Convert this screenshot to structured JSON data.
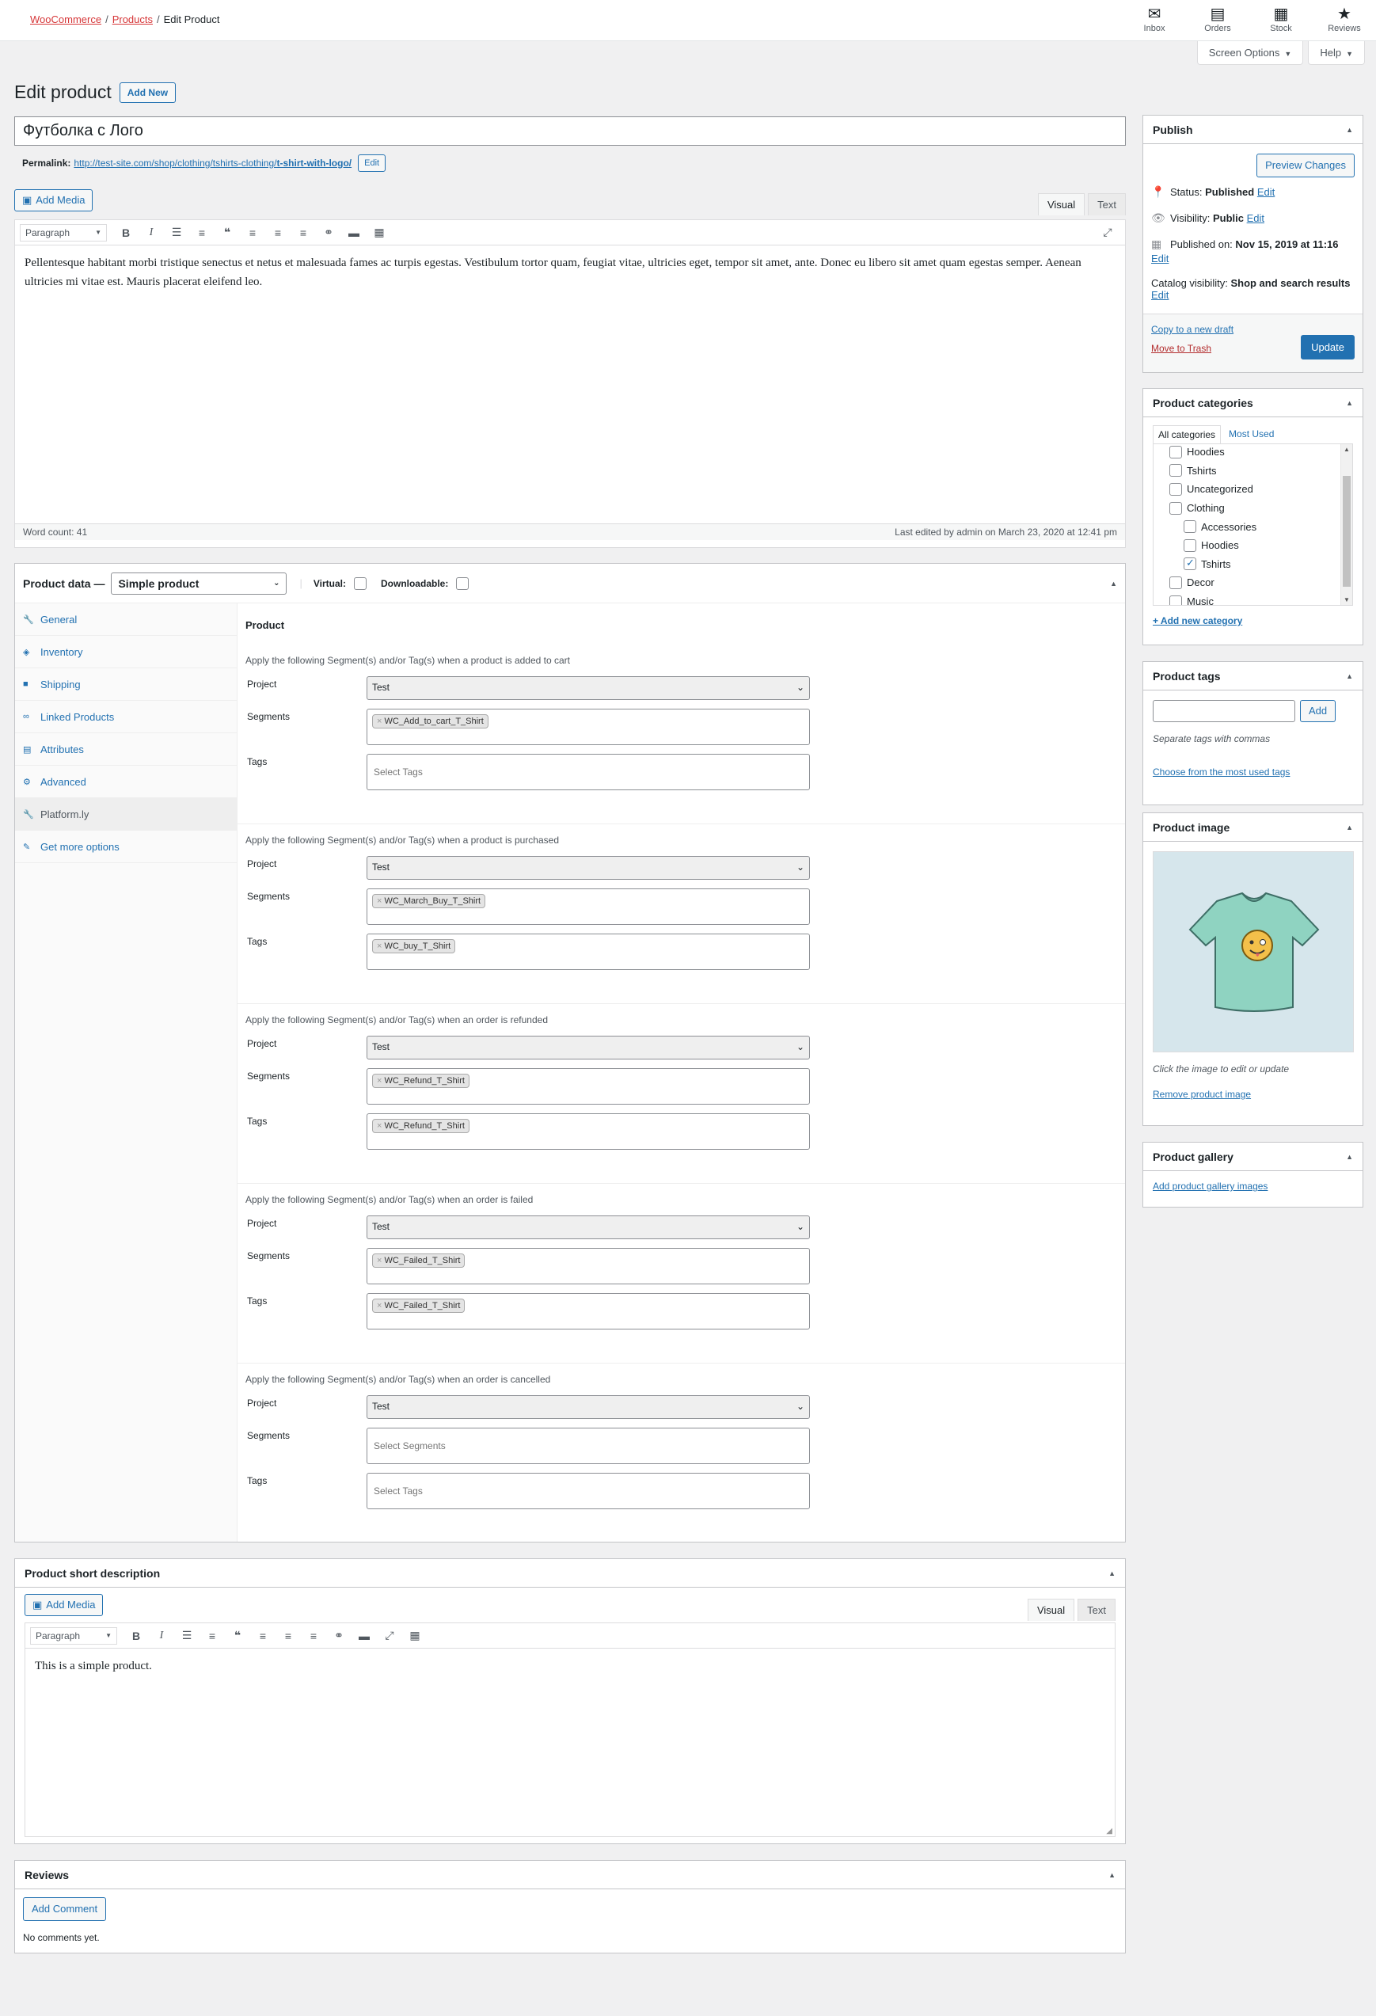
{
  "breadcrumb": {
    "items": [
      "WooCommerce",
      "Products",
      "Edit Product"
    ]
  },
  "activity": [
    {
      "label": "Inbox",
      "icon": "inbox-icon",
      "glyph": "✉"
    },
    {
      "label": "Orders",
      "icon": "orders-icon",
      "glyph": "▤"
    },
    {
      "label": "Stock",
      "icon": "stock-icon",
      "glyph": "▦"
    },
    {
      "label": "Reviews",
      "icon": "star-icon",
      "glyph": "★"
    }
  ],
  "screen_meta": {
    "options": "Screen Options",
    "help": "Help"
  },
  "page": {
    "title": "Edit product",
    "add_new": "Add New"
  },
  "post": {
    "title": "Футболка с Лого",
    "permalink_label": "Permalink:",
    "permalink_base": "http://test-site.com/shop/clothing/tshirts-clothing/",
    "permalink_slug": "t-shirt-with-logo/",
    "permalink_edit": "Edit"
  },
  "editor": {
    "add_media": "Add Media",
    "tab_visual": "Visual",
    "tab_text": "Text",
    "format": "Paragraph",
    "content": "Pellentesque habitant morbi tristique senectus et netus et malesuada fames ac turpis egestas. Vestibulum tortor quam, feugiat vitae, ultricies eget, tempor sit amet, ante. Donec eu libero sit amet quam egestas semper. Aenean ultricies mi vitae est. Mauris placerat eleifend leo.",
    "word_count": "Word count: 41",
    "last_edited": "Last edited by admin on March 23, 2020 at 12:41 pm"
  },
  "product_data": {
    "label": "Product data —",
    "type": "Simple product",
    "virtual": "Virtual:",
    "downloadable": "Downloadable:",
    "tabs": [
      {
        "label": "General",
        "icon": "wrench-icon",
        "glyph": "🔧"
      },
      {
        "label": "Inventory",
        "icon": "tag-icon",
        "glyph": "◈"
      },
      {
        "label": "Shipping",
        "icon": "truck-icon",
        "glyph": "■"
      },
      {
        "label": "Linked Products",
        "icon": "link-icon",
        "glyph": "∞"
      },
      {
        "label": "Attributes",
        "icon": "list-icon",
        "glyph": "▤"
      },
      {
        "label": "Advanced",
        "icon": "gear-icon",
        "glyph": "⚙"
      },
      {
        "label": "Platform.ly",
        "icon": "wrench-icon",
        "glyph": "🔧"
      },
      {
        "label": "Get more options",
        "icon": "plugin-icon",
        "glyph": "✎"
      }
    ],
    "panel_title": "Product",
    "labels": {
      "project": "Project",
      "segments": "Segments",
      "tags": "Tags"
    },
    "sections": [
      {
        "desc": "Apply the following Segment(s) and/or Tag(s) when a product is added to cart",
        "project": "Test",
        "segments": [
          "WC_Add_to_cart_T_Shirt"
        ],
        "segments_ph": "Select Segments",
        "tags": [],
        "tags_ph": "Select Tags"
      },
      {
        "desc": "Apply the following Segment(s) and/or Tag(s) when a product is purchased",
        "project": "Test",
        "segments": [
          "WC_March_Buy_T_Shirt"
        ],
        "segments_ph": "Select Segments",
        "tags": [
          "WC_buy_T_Shirt"
        ],
        "tags_ph": "Select Tags"
      },
      {
        "desc": "Apply the following Segment(s) and/or Tag(s) when an order is refunded",
        "project": "Test",
        "segments": [
          "WC_Refund_T_Shirt"
        ],
        "segments_ph": "Select Segments",
        "tags": [
          "WC_Refund_T_Shirt"
        ],
        "tags_ph": "Select Tags"
      },
      {
        "desc": "Apply the following Segment(s) and/or Tag(s) when an order is failed",
        "project": "Test",
        "segments": [
          "WC_Failed_T_Shirt"
        ],
        "segments_ph": "Select Segments",
        "tags": [
          "WC_Failed_T_Shirt"
        ],
        "tags_ph": "Select Tags"
      },
      {
        "desc": "Apply the following Segment(s) and/or Tag(s) when an order is cancelled",
        "project": "Test",
        "segments": [],
        "segments_ph": "Select Segments",
        "tags": [],
        "tags_ph": "Select Tags"
      }
    ]
  },
  "short_description": {
    "title": "Product short description",
    "add_media": "Add Media",
    "tab_visual": "Visual",
    "tab_text": "Text",
    "format": "Paragraph",
    "content": "This is a simple product."
  },
  "reviews": {
    "title": "Reviews",
    "add_comment": "Add Comment",
    "empty": "No comments yet."
  },
  "publish": {
    "title": "Publish",
    "preview": "Preview Changes",
    "status_label": "Status:",
    "status": "Published",
    "visibility_label": "Visibility:",
    "visibility": "Public",
    "published_label": "Published on:",
    "published": "Nov 15, 2019 at 11:16",
    "catalog_label": "Catalog visibility:",
    "catalog": "Shop and search results",
    "edit": "Edit",
    "copy_draft": "Copy to a new draft",
    "trash": "Move to Trash",
    "update": "Update"
  },
  "categories": {
    "title": "Product categories",
    "tab_all": "All categories",
    "tab_most": "Most Used",
    "items": [
      {
        "label": "Hoodies",
        "level": 1,
        "checked": false
      },
      {
        "label": "Tshirts",
        "level": 1,
        "checked": false
      },
      {
        "label": "Uncategorized",
        "level": 1,
        "checked": false
      },
      {
        "label": "Clothing",
        "level": 1,
        "checked": false
      },
      {
        "label": "Accessories",
        "level": 2,
        "checked": false
      },
      {
        "label": "Hoodies",
        "level": 2,
        "checked": false
      },
      {
        "label": "Tshirts",
        "level": 2,
        "checked": true
      },
      {
        "label": "Decor",
        "level": 1,
        "checked": false
      },
      {
        "label": "Music",
        "level": 1,
        "checked": false
      }
    ],
    "add_new": "+ Add new category"
  },
  "tags": {
    "title": "Product tags",
    "add": "Add",
    "hint": "Separate tags with commas",
    "choose": "Choose from the most used tags"
  },
  "product_image": {
    "title": "Product image",
    "hint": "Click the image to edit or update",
    "remove": "Remove product image"
  },
  "gallery": {
    "title": "Product gallery",
    "add": "Add product gallery images"
  },
  "colors": {
    "accent": "#2271b1",
    "danger": "#d63638",
    "background": "#f0f0f1",
    "shirt": "#8fd3c1"
  }
}
